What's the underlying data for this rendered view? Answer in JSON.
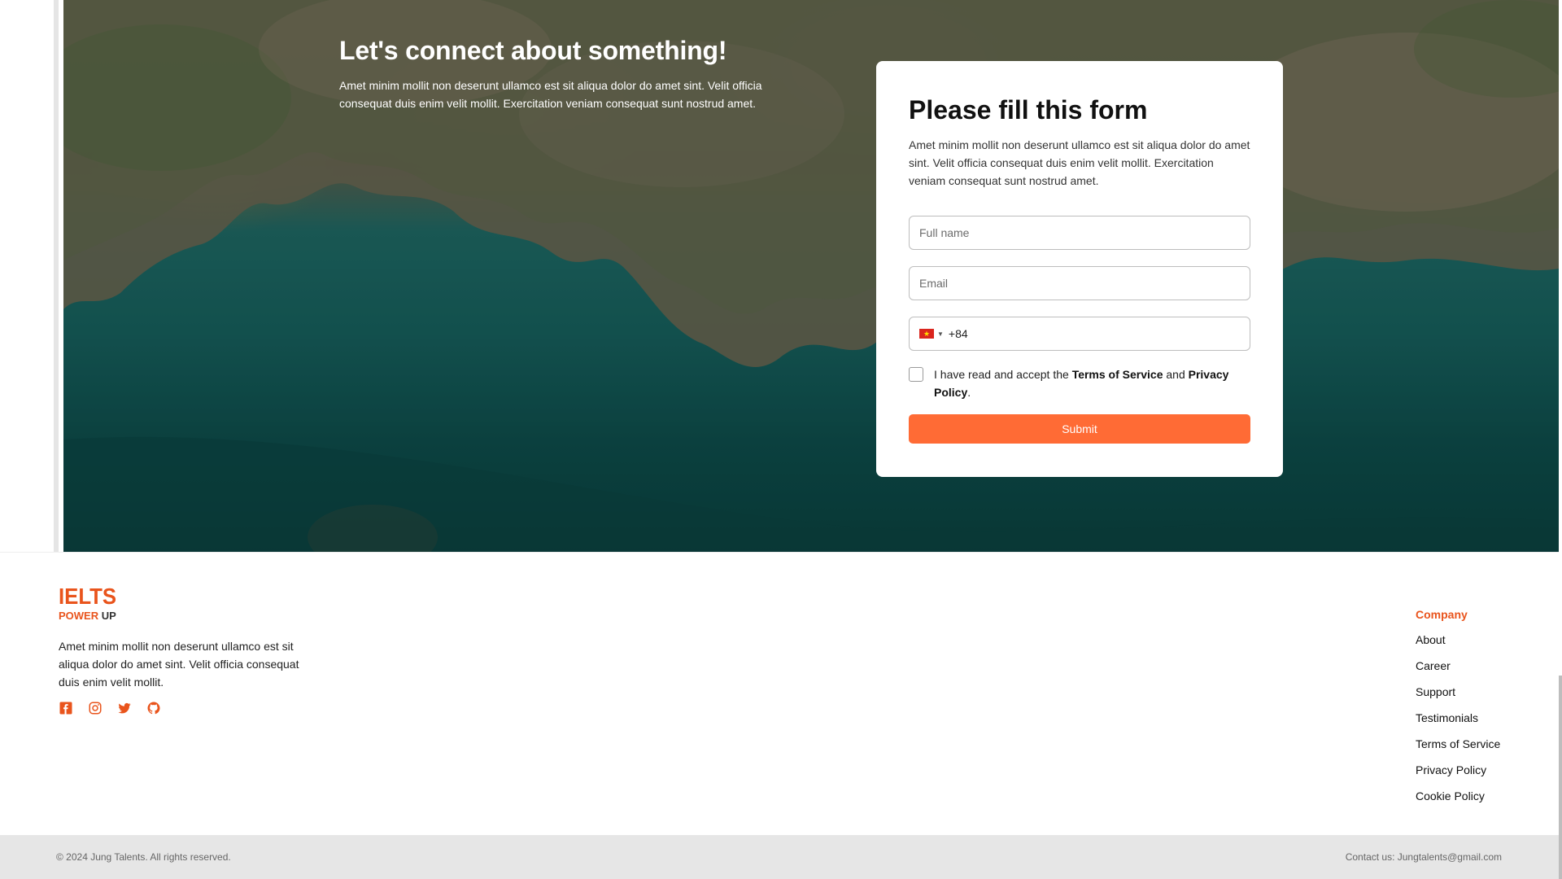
{
  "hero": {
    "title": "Let's connect about something!",
    "description": "Amet minim mollit non deserunt ullamco est sit aliqua dolor do amet sint. Velit officia consequat duis enim velit mollit. Exercitation veniam consequat sunt nostrud amet."
  },
  "form": {
    "title": "Please fill this form",
    "description": "Amet minim mollit non deserunt ullamco est sit aliqua dolor do amet sint. Velit officia consequat duis enim velit mollit. Exercitation veniam consequat sunt nostrud amet.",
    "fullname_placeholder": "Full name",
    "email_placeholder": "Email",
    "phone_dial_code": "+84",
    "agree_prefix": "I have read and accept the",
    "terms_label": "Terms of Service",
    "agree_and": "and",
    "privacy_label": "Privacy Policy",
    "agree_suffix": ".",
    "submit_label": "Submit"
  },
  "footer": {
    "logo_main": "IELTS",
    "logo_power": "POWER",
    "logo_up": "UP",
    "description": "Amet minim mollit non deserunt ullamco est sit aliqua dolor do amet sint. Velit officia consequat duis enim velit mollit.",
    "social_icons": [
      "facebook-icon",
      "instagram-icon",
      "twitter-icon",
      "github-icon"
    ],
    "company_title": "Company",
    "company_links": [
      "About",
      "Career",
      "Support",
      "Testimonials",
      "Terms of Service",
      "Privacy Policy",
      "Cookie Policy"
    ],
    "copyright": "© 2024 Jung Talents. All rights reserved.",
    "contact": "Contact us: Jungtalents@gmail.com"
  },
  "colors": {
    "accent": "#ff6b35",
    "brand": "#e9541c",
    "water": "#17625f",
    "bottom_bar": "#e6e6e6"
  }
}
